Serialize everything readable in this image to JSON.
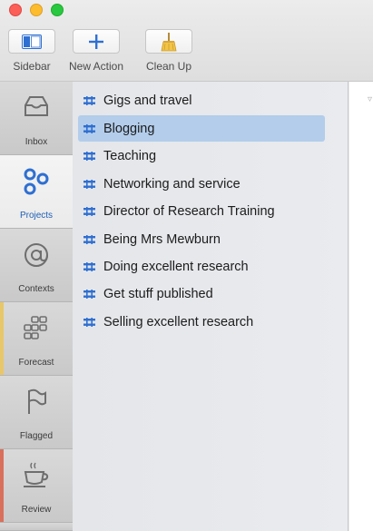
{
  "toolbar": {
    "sidebar_label": "Sidebar",
    "new_action_label": "New Action",
    "cleanup_label": "Clean Up"
  },
  "perspectives": [
    {
      "label": "Inbox",
      "icon": "inbox-icon"
    },
    {
      "label": "Projects",
      "icon": "projects-icon",
      "active": true
    },
    {
      "label": "Contexts",
      "icon": "at-sign-icon"
    },
    {
      "label": "Forecast",
      "icon": "forecast-grid-icon",
      "stripe": "#e8c76a"
    },
    {
      "label": "Flagged",
      "icon": "flag-icon"
    },
    {
      "label": "Review",
      "icon": "coffee-cup-icon",
      "stripe": "#d9705c"
    }
  ],
  "projects": [
    {
      "name": "Gigs and travel"
    },
    {
      "name": "Blogging",
      "selected": true
    },
    {
      "name": "Teaching"
    },
    {
      "name": "Networking and service"
    },
    {
      "name": "Director of Research Training"
    },
    {
      "name": "Being Mrs Mewburn"
    },
    {
      "name": "Doing excellent research"
    },
    {
      "name": "Get stuff published"
    },
    {
      "name": "Selling excellent research"
    }
  ],
  "content": {
    "corner_mark": "▿"
  },
  "colors": {
    "accent": "#1e5fb5",
    "selection": "#b3cdeb",
    "forecast_stripe": "#e8c76a",
    "review_stripe": "#d9705c"
  }
}
